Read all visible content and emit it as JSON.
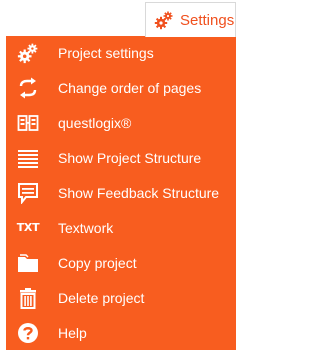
{
  "tab": {
    "label": "Settings",
    "icon": "gears-icon",
    "accent": "#f0501e"
  },
  "menu": {
    "background": "#f85d1f",
    "items": [
      {
        "label": "Project settings",
        "icon": "gears-icon"
      },
      {
        "label": "Change order of pages",
        "icon": "reorder-arrows-icon"
      },
      {
        "label": "questlogix®",
        "icon": "questlogix-icon"
      },
      {
        "label": "Show Project Structure",
        "icon": "structure-lines-icon"
      },
      {
        "label": "Show Feedback Structure",
        "icon": "feedback-bubble-icon"
      },
      {
        "label": "Textwork",
        "icon": "txt-icon",
        "glyph": "TXT"
      },
      {
        "label": "Copy project",
        "icon": "folder-icon"
      },
      {
        "label": "Delete project",
        "icon": "trash-icon"
      },
      {
        "label": "Help",
        "icon": "help-icon"
      }
    ]
  }
}
